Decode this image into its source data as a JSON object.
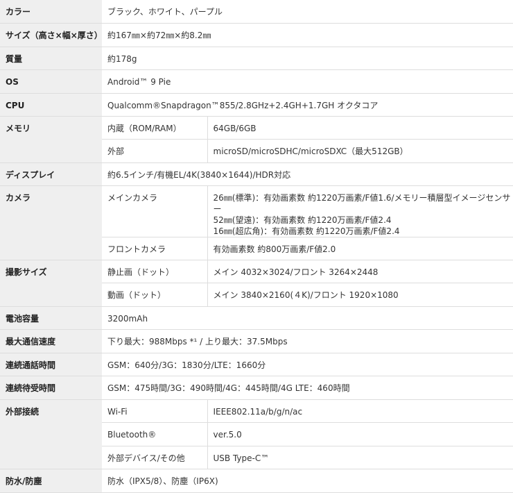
{
  "rows": {
    "color": {
      "label": "カラー",
      "value": "ブラック、ホワイト、パープル"
    },
    "size": {
      "label": "サイズ（高さ×幅×厚さ）",
      "value": "約167㎜×約72㎜×約8.2㎜"
    },
    "weight": {
      "label": "質量",
      "value": "約178g"
    },
    "os": {
      "label": "OS",
      "value": "Android™ 9 Pie"
    },
    "cpu": {
      "label": "CPU",
      "value": "Qualcomm®Snapdragon™855/2.8GHz+2.4GH+1.7GH オクタコア"
    },
    "memory": {
      "label": "メモリ",
      "internal_label": "内蔵（ROM/RAM）",
      "internal_value": "64GB/6GB",
      "external_label": "外部",
      "external_value": "microSD/microSDHC/microSDXC（最大512GB）"
    },
    "display": {
      "label": "ディスプレイ",
      "value": "約6.5インチ/有機EL/4K(3840×1644)/HDR対応"
    },
    "camera": {
      "label": "カメラ",
      "main_label": "メインカメラ",
      "main_value": "26㎜(標準)：有効画素数 約1220万画素/F値1.6/メモリー積層型イメージセンサー\n52㎜(望遠)：有効画素数 約1220万画素/F値2.4\n16㎜(超広角)：有効画素数 約1220万画素/F値2.4",
      "front_label": "フロントカメラ",
      "front_value": "有効画素数 約800万画素/F値2.0"
    },
    "capture": {
      "label": "撮影サイズ",
      "still_label": "静止画（ドット）",
      "still_value": "メイン 4032×3024/フロント 3264×2448",
      "video_label": "動画（ドット）",
      "video_value": "メイン 3840×2160(４K)/フロント 1920×1080"
    },
    "battery": {
      "label": "電池容量",
      "value": "3200mAh"
    },
    "speed": {
      "label": "最大通信速度",
      "value": "下り最大：988Mbps *¹ / 上り最大：37.5Mbps"
    },
    "talk": {
      "label": "連続通話時間",
      "value": "GSM：640分/3G：1830分/LTE：1660分"
    },
    "standby": {
      "label": "連続待受時間",
      "value": "GSM：475時間/3G：490時間/4G：445時間/4G LTE：460時間"
    },
    "ext": {
      "label": "外部接続",
      "wifi_label": "Wi-Fi",
      "wifi_value": "IEEE802.11a/b/g/n/ac",
      "bt_label": "Bluetooth®",
      "bt_value": "ver.5.0",
      "dev_label": "外部デバイス/その他",
      "dev_value": "USB Type-C™"
    },
    "water": {
      "label": "防水/防塵",
      "value": "防水（IPX5/8）、防塵（IP6X)"
    }
  }
}
